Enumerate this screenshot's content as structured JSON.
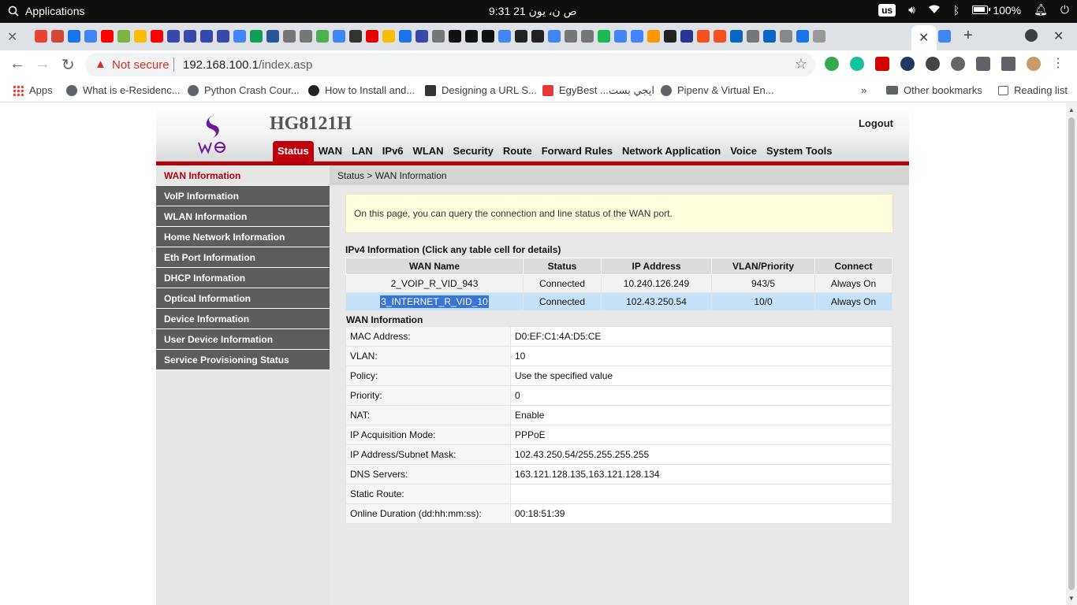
{
  "os": {
    "apps_label": "Applications",
    "clock": "9:31 ص  ن، يون 21",
    "keyboard_layout": "us",
    "battery": "100%"
  },
  "browser": {
    "url_warning": "Not secure",
    "url_host": "192.168.100.1",
    "url_path": "/index.asp",
    "bookmarks": [
      {
        "label": "Apps"
      },
      {
        "label": "What is e-Residenc..."
      },
      {
        "label": "Python Crash Cour..."
      },
      {
        "label": "How to Install and..."
      },
      {
        "label": "Designing a URL S..."
      },
      {
        "label": "EgyBest ...ايجي بست"
      },
      {
        "label": "Pipenv & Virtual En..."
      }
    ],
    "overflow": "»",
    "other_bookmarks": "Other bookmarks",
    "reading_list": "Reading list"
  },
  "router": {
    "model": "HG8121H",
    "logout": "Logout",
    "menu": [
      "Status",
      "WAN",
      "LAN",
      "IPv6",
      "WLAN",
      "Security",
      "Route",
      "Forward Rules",
      "Network Application",
      "Voice",
      "System Tools"
    ],
    "sidebar": [
      "WAN Information",
      "VoIP Information",
      "WLAN Information",
      "Home Network Information",
      "Eth Port Information",
      "DHCP Information",
      "Optical Information",
      "Device Information",
      "User Device Information",
      "Service Provisioning Status"
    ],
    "breadcrumb": "Status > WAN Information",
    "notice": "On this page, you can query the connection and line status of the WAN port.",
    "ipv4_title": "IPv4 Information (Click any table cell for details)",
    "wan_table": {
      "headers": [
        "WAN Name",
        "Status",
        "IP Address",
        "VLAN/Priority",
        "Connect"
      ],
      "rows": [
        [
          "2_VOIP_R_VID_943",
          "Connected",
          "10.240.126.249",
          "943/5",
          "Always On"
        ],
        [
          "3_INTERNET_R_VID_10",
          "Connected",
          "102.43.250.54",
          "10/0",
          "Always On"
        ]
      ]
    },
    "wan_info_title": "WAN Information",
    "wan_info": [
      {
        "k": "MAC Address:",
        "v": "D0:EF:C1:4A:D5:CE"
      },
      {
        "k": "VLAN:",
        "v": "10"
      },
      {
        "k": "Policy:",
        "v": "Use the specified value"
      },
      {
        "k": "Priority:",
        "v": "0"
      },
      {
        "k": "NAT:",
        "v": "Enable"
      },
      {
        "k": "IP Acquisition Mode:",
        "v": "PPPoE"
      },
      {
        "k": "IP Address/Subnet Mask:",
        "v": "102.43.250.54/255.255.255.255"
      },
      {
        "k": "DNS Servers:",
        "v": "163.121.128.135,163.121.128.134"
      },
      {
        "k": "Static Route:",
        "v": ""
      },
      {
        "k": "Online Duration (dd:hh:mm:ss):",
        "v": "00:18:51:39"
      }
    ],
    "accent_color": "#b3000a"
  }
}
